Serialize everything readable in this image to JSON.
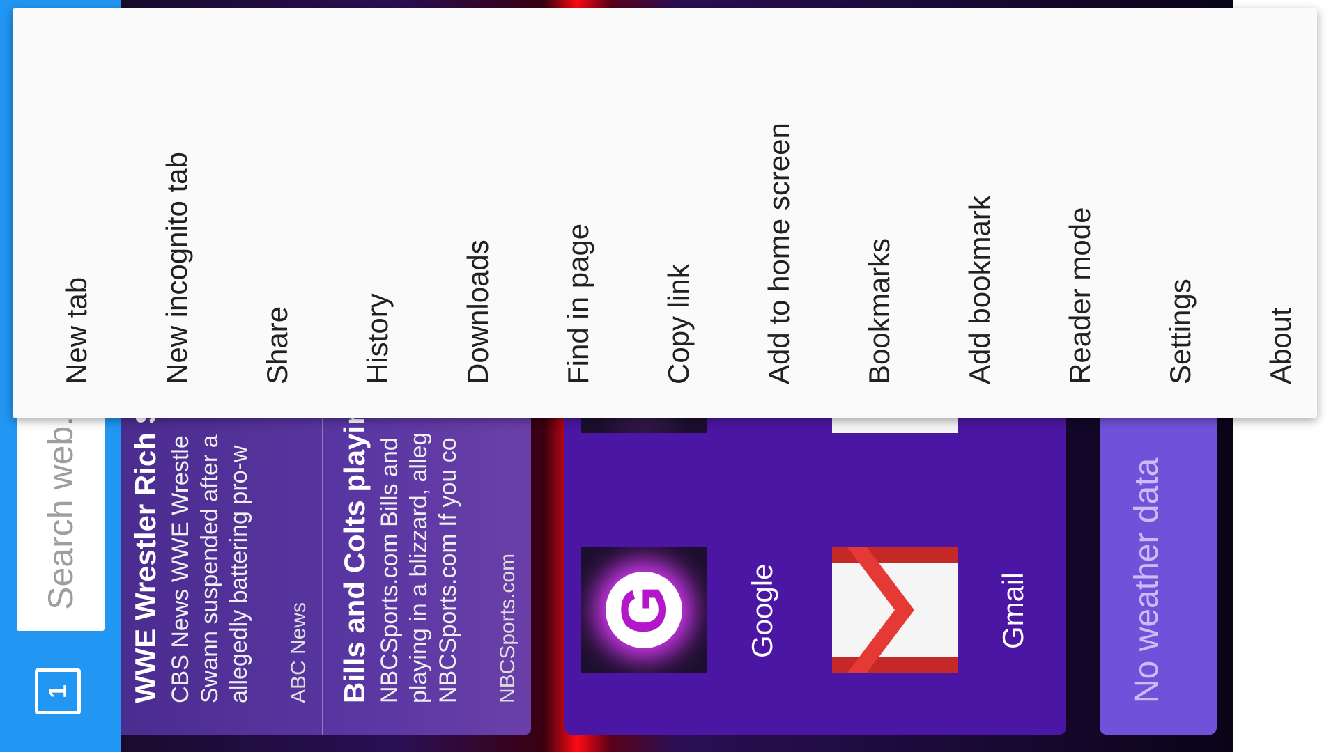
{
  "toolbar": {
    "tab_count": "1",
    "search_placeholder": "Search web..."
  },
  "news": [
    {
      "headline": "WWE Wrestler Rich S",
      "lines": [
        "CBS News WWE Wrestle",
        "Swann suspended after a",
        "allegedly battering pro-w"
      ],
      "source": "ABC News"
    },
    {
      "headline": "Bills and Colts playin",
      "lines": [
        "NBCSports.com Bills and",
        "playing in a blizzard, alleg",
        "NBCSports.com If you co"
      ],
      "source": "NBCSports.com"
    }
  ],
  "speed_dial": [
    {
      "label": "Google",
      "icon": "google-icon"
    },
    {
      "label": "Gmail",
      "icon": "gmail-icon"
    }
  ],
  "weather": {
    "text": "No weather data"
  },
  "menu": {
    "items": [
      "New tab",
      "New incognito tab",
      "Share",
      "History",
      "Downloads",
      "Find in page",
      "Copy link",
      "Add to home screen",
      "Bookmarks",
      "Add bookmark",
      "Reader mode",
      "Settings",
      "About"
    ]
  },
  "colors": {
    "toolbar": "#2196F3",
    "menu_bg": "#fafafa",
    "speed_dial_bg": "#4b16a3",
    "weather_bg": "#6f52d9",
    "gmail_red": "#e53935"
  }
}
